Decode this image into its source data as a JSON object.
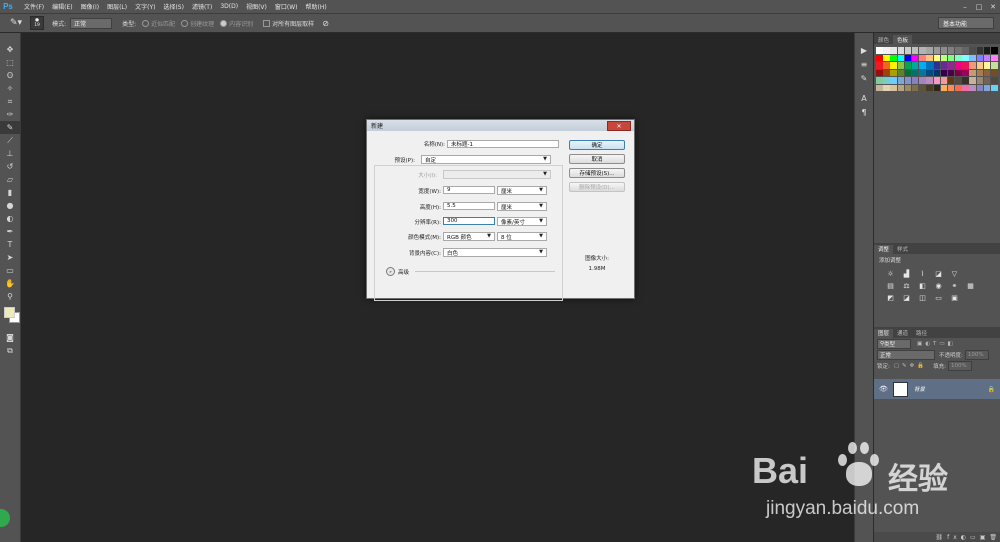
{
  "app": {
    "logo": "Ps"
  },
  "menubar": {
    "items": [
      "文件(F)",
      "编辑(E)",
      "图像(I)",
      "图层(L)",
      "文字(Y)",
      "选择(S)",
      "滤镜(T)",
      "3D(D)",
      "视图(V)",
      "窗口(W)",
      "帮助(H)"
    ],
    "window_controls": [
      "–",
      "□",
      "✕"
    ]
  },
  "options_bar": {
    "brush_size": "19",
    "mode_label": "模式:",
    "mode_value": "正常",
    "type_label": "类型:",
    "type_options": [
      "近似匹配",
      "创建纹理",
      "内容识别"
    ],
    "sample_all_layers": "对所有图层取样",
    "workspace": "基本功能"
  },
  "right_panel": {
    "swatch_tabs": [
      "颜色",
      "色板"
    ],
    "adj_tabs": [
      "调整",
      "样式"
    ],
    "adj_title": "添加调整",
    "layers_tabs": [
      "图层",
      "通道",
      "路径"
    ],
    "kind_label": "类型",
    "blend_mode": "正常",
    "opacity_label": "不透明度:",
    "opacity_value": "100%",
    "lock_label": "锁定:",
    "fill_label": "填充:",
    "fill_value": "100%",
    "layer_name": "背景",
    "swatch_colors": [
      "#ffffff",
      "#f2f2f2",
      "#e6e6e6",
      "#d9d9d9",
      "#cccccc",
      "#bfbfbf",
      "#b3b3b3",
      "#a6a6a6",
      "#999999",
      "#8c8c8c",
      "#808080",
      "#737373",
      "#666666",
      "#4d4d4d",
      "#333333",
      "#1a1a1a",
      "#000000",
      "#ff0000",
      "#ffff00",
      "#00ff00",
      "#00ffff",
      "#0000ff",
      "#ff00ff",
      "#ff7f7f",
      "#ffbf7f",
      "#ffff7f",
      "#bfff7f",
      "#7fff7f",
      "#7fffbf",
      "#7fffff",
      "#7fbfff",
      "#7f7fff",
      "#bf7fff",
      "#ff7fff",
      "#ed1c24",
      "#f26522",
      "#fff200",
      "#8dc63f",
      "#00a651",
      "#00a99d",
      "#00aeef",
      "#0072bc",
      "#2e3192",
      "#662d91",
      "#92278f",
      "#ec008c",
      "#ed145b",
      "#f7977a",
      "#fdc68a",
      "#fff79a",
      "#c4df9b",
      "#9e0b0f",
      "#a0410d",
      "#aba000",
      "#598527",
      "#007236",
      "#00746b",
      "#0076a3",
      "#004a80",
      "#003471",
      "#32004b",
      "#4b0049",
      "#7b0046",
      "#9e005d",
      "#c69c6d",
      "#a67c52",
      "#8c6239",
      "#754c24",
      "#82ca9c",
      "#7accc8",
      "#6dcff6",
      "#7da7d9",
      "#8393ca",
      "#8781bd",
      "#a187be",
      "#bd8cbf",
      "#f49ac2",
      "#f6989d",
      "#603913",
      "#534741",
      "#362f2d",
      "#c7b299",
      "#998675",
      "#736357",
      "#534741",
      "#c2b59b",
      "#e2d3b5",
      "#d4c5a3",
      "#b7a582",
      "#998964",
      "#7c6e4f",
      "#605338",
      "#453c27",
      "#2b251a",
      "#fbaf5d",
      "#f68e56",
      "#f26c4f",
      "#ef6ea8",
      "#bd8cbf",
      "#8882be",
      "#7ea7d8",
      "#6ecff6"
    ]
  },
  "dialog": {
    "title": "新建",
    "close": "✕",
    "name_label": "名称(N):",
    "name_value": "未标题-1",
    "preset_label": "预设(P):",
    "preset_value": "自定",
    "size_label": "大小(I):",
    "size_value": "",
    "width_label": "宽度(W):",
    "width_value": "9",
    "width_unit": "厘米",
    "height_label": "高度(H):",
    "height_value": "5.5",
    "height_unit": "厘米",
    "resolution_label": "分辨率(R):",
    "resolution_value": "300",
    "resolution_unit": "像素/英寸",
    "color_mode_label": "颜色模式(M):",
    "color_mode_value": "RGB 颜色",
    "bit_depth": "8 位",
    "background_label": "背景内容(C):",
    "background_value": "白色",
    "advanced_label": "高级",
    "ok": "确定",
    "cancel": "取消",
    "save_preset": "存储预设(S)...",
    "delete_preset": "删除预设(D)...",
    "image_size_label": "图像大小:",
    "image_size_value": "1.98M"
  },
  "watermark": {
    "brand": "Bai",
    "brand2": "经验",
    "url": "jingyan.baidu.com"
  }
}
